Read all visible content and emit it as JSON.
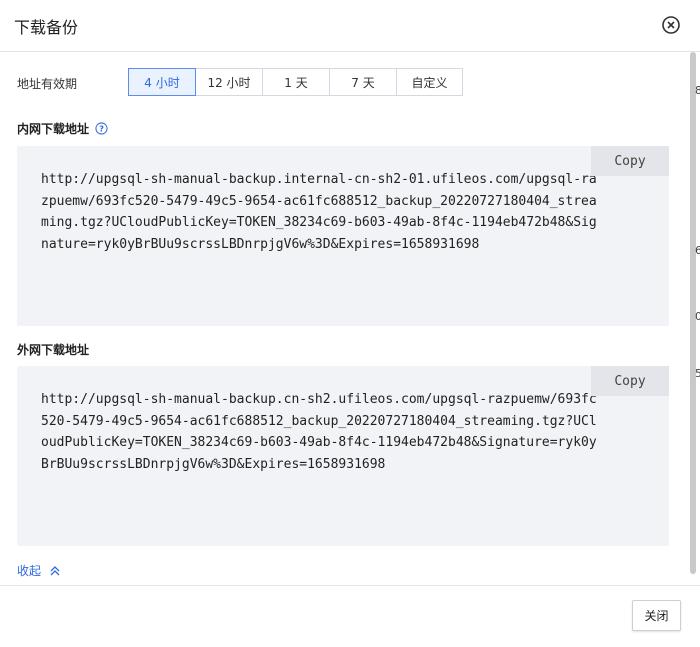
{
  "dialog": {
    "title": "下载备份",
    "close_icon": "close-circle-icon"
  },
  "validity": {
    "label": "地址有效期",
    "options": [
      "4 小时",
      "12 小时",
      "1 天",
      "7 天",
      "自定义"
    ],
    "selected": "4 小时"
  },
  "internal": {
    "label": "内网下载地址",
    "help_icon": "question-circle-icon",
    "copy_label": "Copy",
    "url": "http://upgsql-sh-manual-backup.internal-cn-sh2-01.ufileos.com/upgsql-razpuemw/693fc520-5479-49c5-9654-ac61fc688512_backup_20220727180404_streaming.tgz?UCloudPublicKey=TOKEN_38234c69-b603-49ab-8f4c-1194eb472b48&Signature=ryk0yBrBUu9scrssLBDnrpjgV6w%3D&Expires=1658931698"
  },
  "external": {
    "label": "外网下载地址",
    "copy_label": "Copy",
    "url": "http://upgsql-sh-manual-backup.cn-sh2.ufileos.com/upgsql-razpuemw/693fc520-5479-49c5-9654-ac61fc688512_backup_20220727180404_streaming.tgz?UCloudPublicKey=TOKEN_38234c69-b603-49ab-8f4c-1194eb472b48&Signature=ryk0yBrBUu9scrssLBDnrpjgV6w%3D&Expires=1658931698"
  },
  "collapse": {
    "label": "收起",
    "icon": "double-chevron-up-icon"
  },
  "footer": {
    "close_label": "关闭"
  },
  "background_edge": [
    "8",
    "6",
    "0",
    "5"
  ],
  "colors": {
    "accent": "#2d6ae0",
    "active_bg": "#eaf1ff",
    "box_bg": "#f2f3f6"
  }
}
